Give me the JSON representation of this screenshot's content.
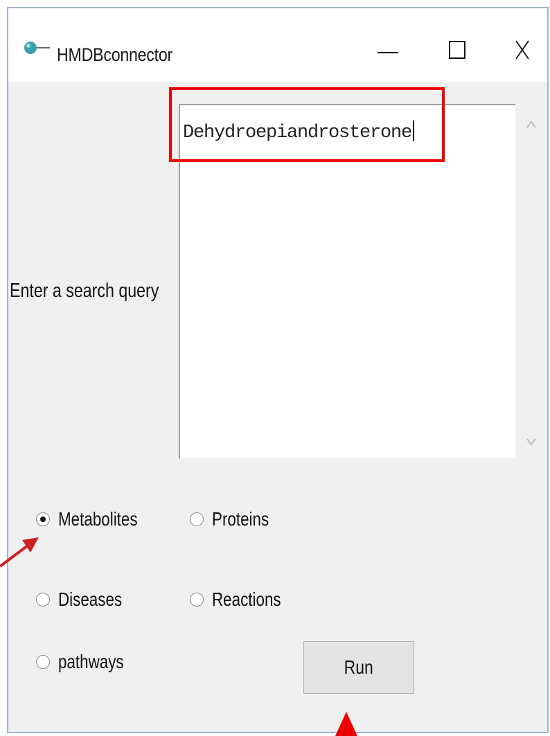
{
  "window": {
    "title": "HMDBconnector",
    "icon": "app-logo-icon",
    "controls": [
      "minimize-icon",
      "maximize-icon",
      "close-icon"
    ]
  },
  "query": {
    "label": "Enter a search query",
    "value": "Dehydroepiandrosterone"
  },
  "categories": [
    {
      "label": "Metabolites",
      "selected": true
    },
    {
      "label": "Proteins",
      "selected": false
    },
    {
      "label": "Diseases",
      "selected": false
    },
    {
      "label": "Reactions",
      "selected": false
    },
    {
      "label": "pathways",
      "selected": false
    }
  ],
  "run_button": {
    "label": "Run"
  },
  "colors": {
    "window_bg": "#f0f0f0",
    "title_bg": "#ffffff",
    "highlight": "#ee0000",
    "arrow_metabolites": "#cc2222",
    "arrow_run": "#ee0000"
  }
}
